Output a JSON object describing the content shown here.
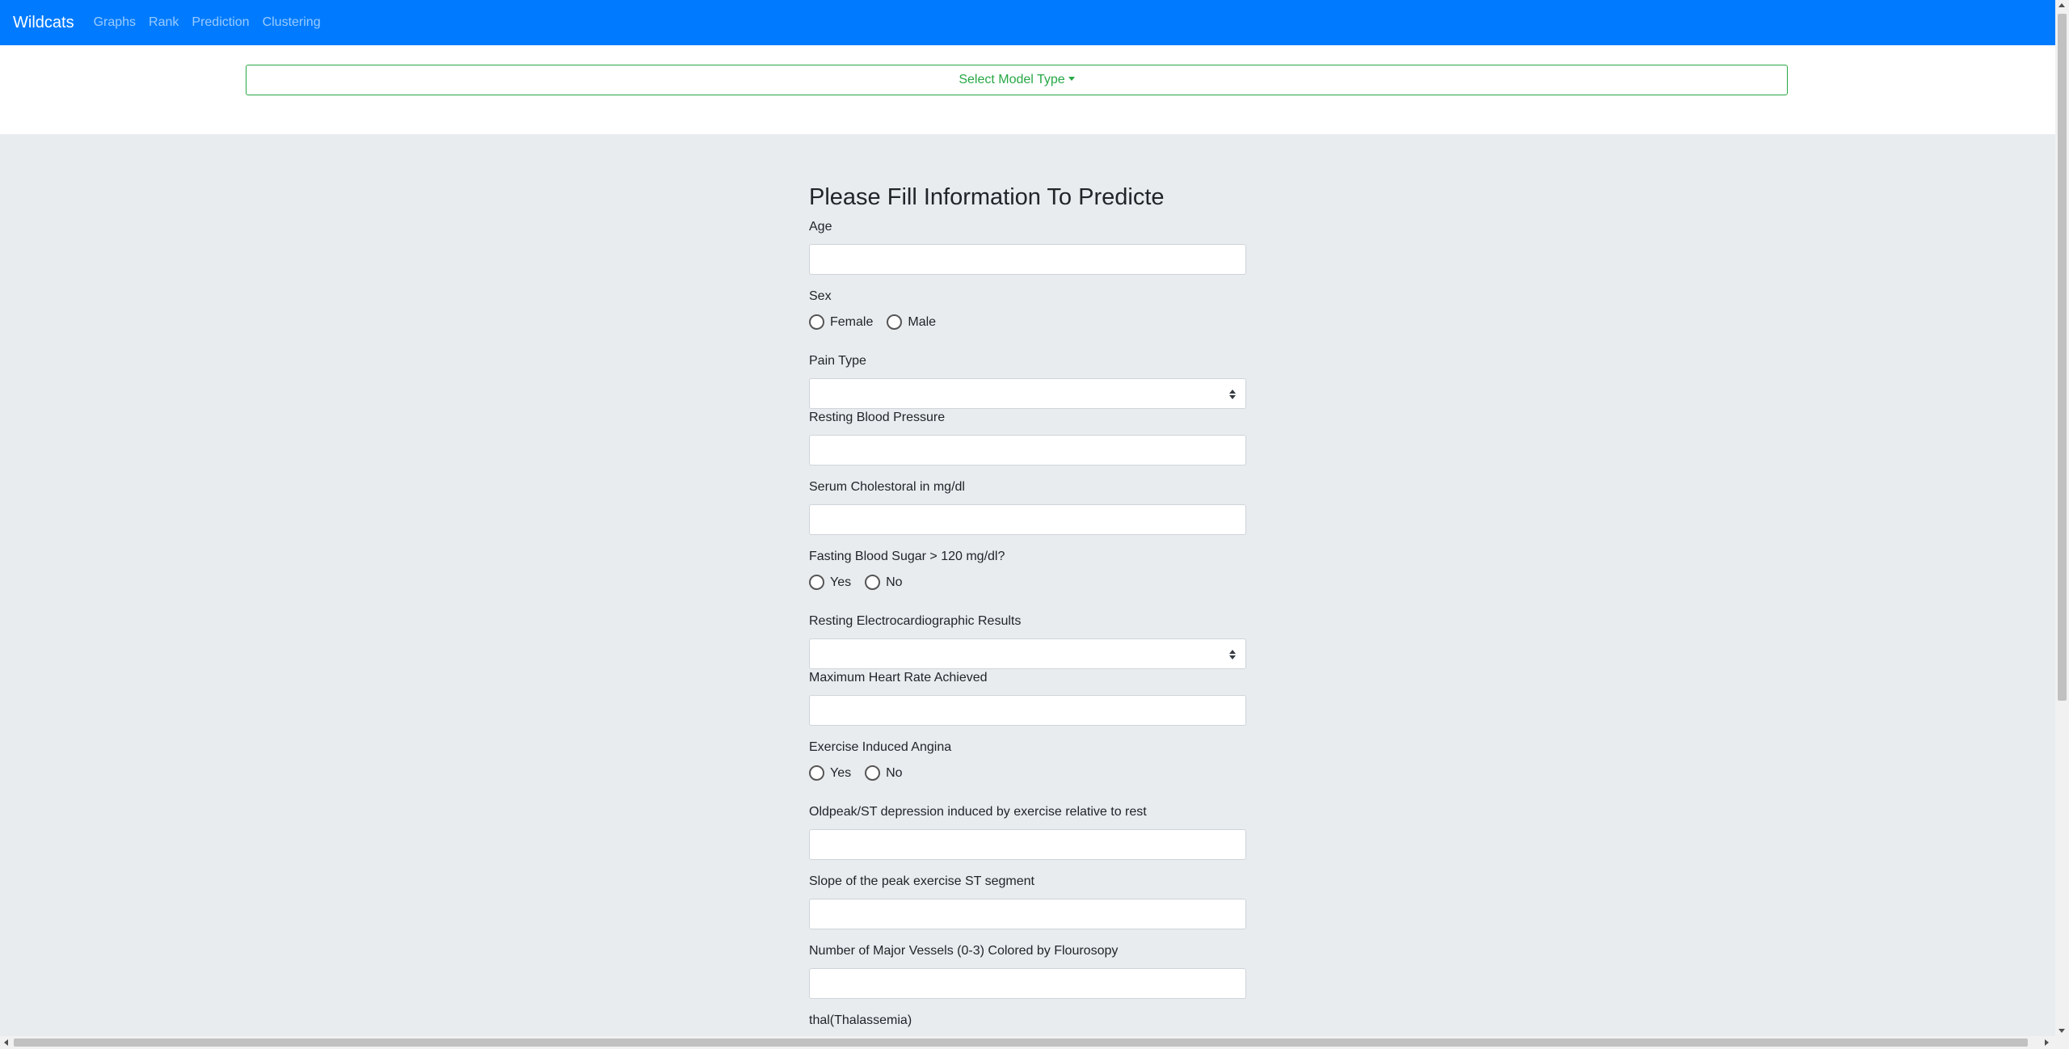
{
  "navbar": {
    "brand": "Wildcats",
    "links": [
      "Graphs",
      "Rank",
      "Prediction",
      "Clustering"
    ],
    "background_color": "#007bff"
  },
  "model_select": {
    "label": "Select Model Type",
    "color": "#28a745"
  },
  "form": {
    "title": "Please Fill Information To Predicte",
    "age": {
      "label": "Age",
      "value": ""
    },
    "sex": {
      "label": "Sex",
      "options": [
        "Female",
        "Male"
      ]
    },
    "pain_type": {
      "label": "Pain Type",
      "selected": ""
    },
    "resting_bp": {
      "label": "Resting Blood Pressure",
      "value": ""
    },
    "cholesterol": {
      "label": "Serum Cholestoral in mg/dl",
      "value": ""
    },
    "fasting_sugar": {
      "label": "Fasting Blood Sugar > 120 mg/dl?",
      "options": [
        "Yes",
        "No"
      ]
    },
    "resting_ecg": {
      "label": "Resting Electrocardiographic Results",
      "selected": ""
    },
    "max_heart_rate": {
      "label": "Maximum Heart Rate Achieved",
      "value": ""
    },
    "angina": {
      "label": "Exercise Induced Angina",
      "options": [
        "Yes",
        "No"
      ]
    },
    "oldpeak": {
      "label": "Oldpeak/ST depression induced by exercise relative to rest",
      "value": ""
    },
    "slope": {
      "label": "Slope of the peak exercise ST segment",
      "value": ""
    },
    "vessels": {
      "label": "Number of Major Vessels (0-3) Colored by Flourosopy",
      "value": ""
    },
    "thal": {
      "label": "thal(Thalassemia)"
    }
  }
}
